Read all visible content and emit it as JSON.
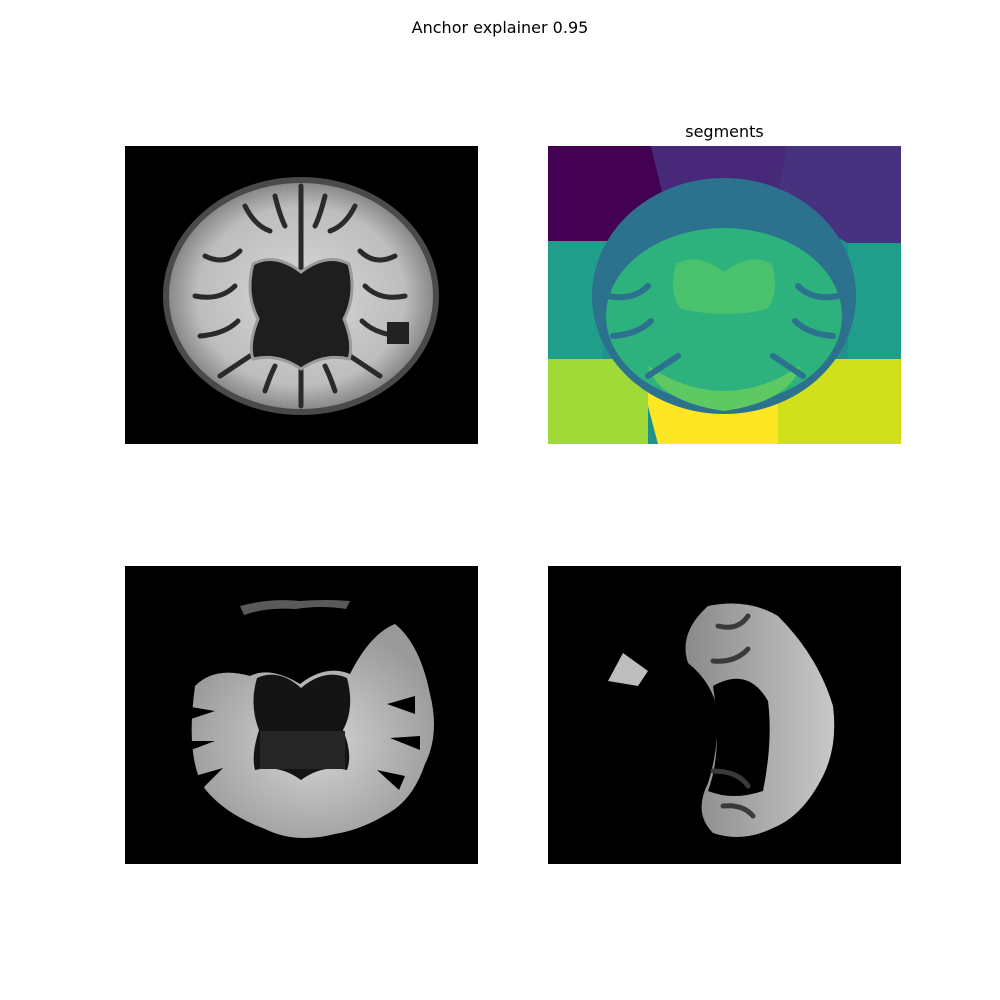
{
  "figure": {
    "title": "Anchor explainer 0.95"
  },
  "panels": {
    "original": {
      "title": ""
    },
    "segments": {
      "title": "segments"
    },
    "anchor_mask_a": {
      "title": ""
    },
    "anchor_mask_b": {
      "title": ""
    }
  },
  "colors": {
    "background": "#000000",
    "viridis": [
      "#440154",
      "#46327e",
      "#365c8d",
      "#277f8e",
      "#1fa187",
      "#4ac16d",
      "#a0da39",
      "#fde725"
    ]
  }
}
